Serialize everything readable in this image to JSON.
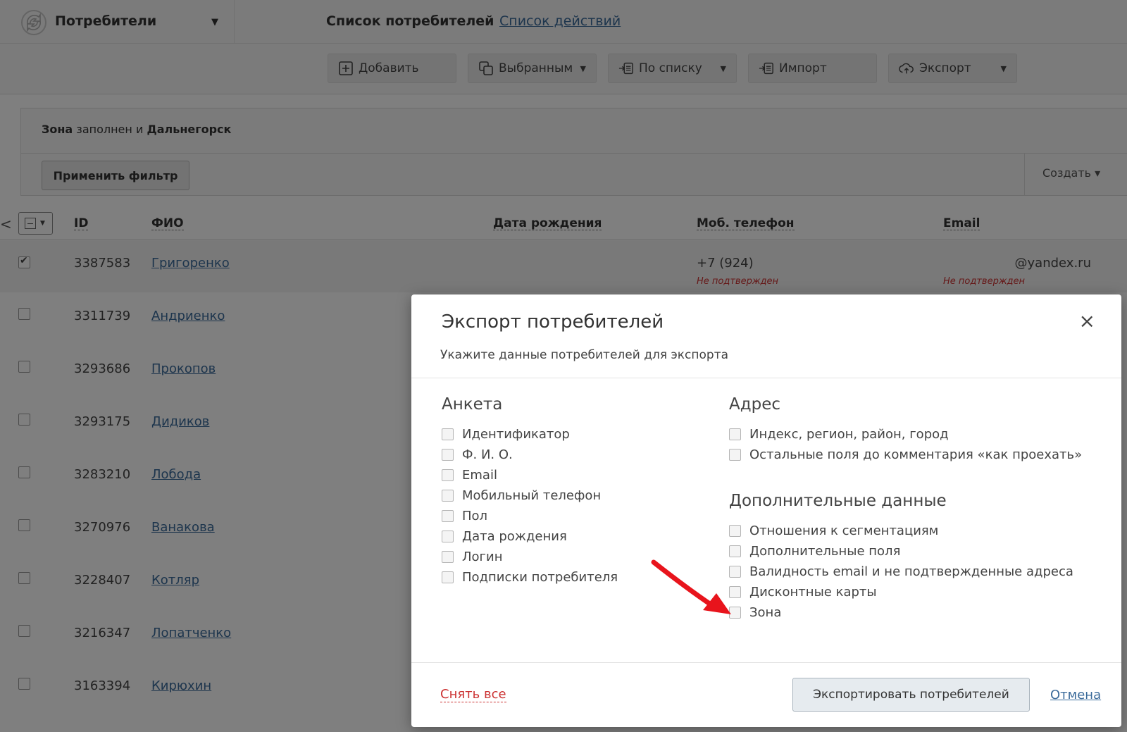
{
  "header": {
    "section_title": "Потребители",
    "tab_active": "Список потребителей",
    "tab_link": "Список действий"
  },
  "toolbar": {
    "add": "Добавить",
    "selected": "Выбранным",
    "by_list": "По списку",
    "import": "Импорт",
    "export": "Экспорт"
  },
  "filter": {
    "part1": "Зона",
    "part2": " заполнен и ",
    "part3": "Дальнегорск",
    "apply": "Применить фильтр",
    "create": "Создать ▾"
  },
  "table": {
    "headers": {
      "id": "ID",
      "fio": "ФИО",
      "birth": "Дата рождения",
      "phone": "Моб. телефон",
      "email": "Email"
    },
    "rows": [
      {
        "id": "3387583",
        "fio": "Григоренко",
        "phone": "+7 (924)",
        "phone_status": "Не подтвержден",
        "email": "@yandex.ru",
        "email_status": "Не подтвержден",
        "checked": true
      },
      {
        "id": "3311739",
        "fio": "Андриенко"
      },
      {
        "id": "3293686",
        "fio": "Прокопов"
      },
      {
        "id": "3293175",
        "fio": "Дидиков"
      },
      {
        "id": "3283210",
        "fio": "Лобода"
      },
      {
        "id": "3270976",
        "fio": "Ванакова"
      },
      {
        "id": "3228407",
        "fio": "Котляр"
      },
      {
        "id": "3216347",
        "fio": "Лопатченко"
      },
      {
        "id": "3163394",
        "fio": "Кирюхин "
      }
    ]
  },
  "modal": {
    "title": "Экспорт потребителей",
    "subtitle": "Укажите данные потребителей для экспорта",
    "close": "×",
    "anketa": {
      "title": "Анкета",
      "options": [
        "Идентификатор",
        "Ф. И. О.",
        "Email",
        "Мобильный телефон",
        "Пол",
        "Дата рождения",
        "Логин",
        "Подписки потребителя"
      ]
    },
    "address": {
      "title": "Адрес",
      "options": [
        "Индекс, регион, район, город",
        "Остальные поля до комментария «как проехать»"
      ]
    },
    "extra": {
      "title": "Дополнительные данные",
      "options": [
        "Отношения к сегментациям",
        "Дополнительные поля",
        "Валидность email и не подтвержденные адреса",
        "Дисконтные карты",
        "Зона"
      ]
    },
    "uncheck_all": "Снять все",
    "export_button": "Экспортировать потребителей",
    "cancel": "Отмена"
  },
  "colors": {
    "link": "#3a6a9a",
    "warning": "#cc3333",
    "annotation_arrow": "#e8141c"
  }
}
